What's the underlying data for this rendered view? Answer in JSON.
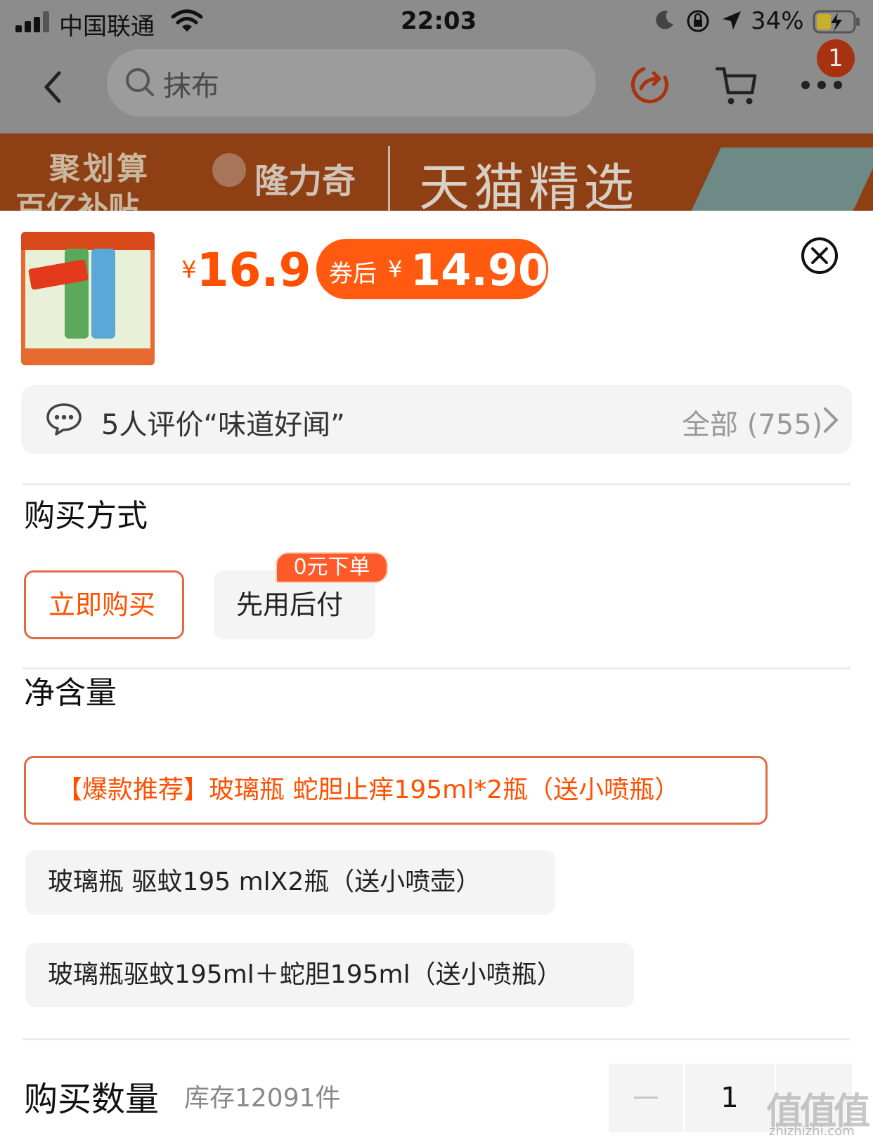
{
  "status_bar": {
    "carrier": "中国联通",
    "time": "22:03",
    "battery_percent": "34%"
  },
  "nav": {
    "search_text": "抹布",
    "more_badge": "1"
  },
  "banner": {
    "line1": "聚划算",
    "line2": "百亿补贴",
    "brand": "隆力奇",
    "channel": "天猫精选"
  },
  "product": {
    "price_currency": "¥",
    "price": "16.9",
    "coupon_label": "券后",
    "coupon_currency": "¥",
    "coupon_price": "14.90"
  },
  "reviews": {
    "summary": "5人评价“味道好闻”",
    "all_label": "全部 (755)"
  },
  "purchase_method": {
    "title": "购买方式",
    "options": [
      {
        "label": "立即购买",
        "selected": true
      },
      {
        "label": "先用后付",
        "selected": false,
        "badge": "0元下单"
      }
    ]
  },
  "net_content": {
    "title": "净含量",
    "options": [
      {
        "label": "【爆款推荐】玻璃瓶 蛇胆止痒195ml*2瓶（送小喷瓶）",
        "selected": true
      },
      {
        "label": "玻璃瓶 驱蚊195  mlX2瓶（送小喷壶）",
        "selected": false
      },
      {
        "label": "玻璃瓶驱蚊195ml＋蛇胆195ml（送小喷瓶）",
        "selected": false
      }
    ]
  },
  "quantity": {
    "title": "购买数量",
    "stock": "库存12091件",
    "value": "1"
  },
  "watermark": {
    "main": "值值值",
    "sub": "zhizhizhi.com"
  },
  "colors": {
    "accent": "#ff5000",
    "selected_border": "#e26a45",
    "option_bg": "#f4f4f4",
    "overlay": "#8c8c8c"
  }
}
